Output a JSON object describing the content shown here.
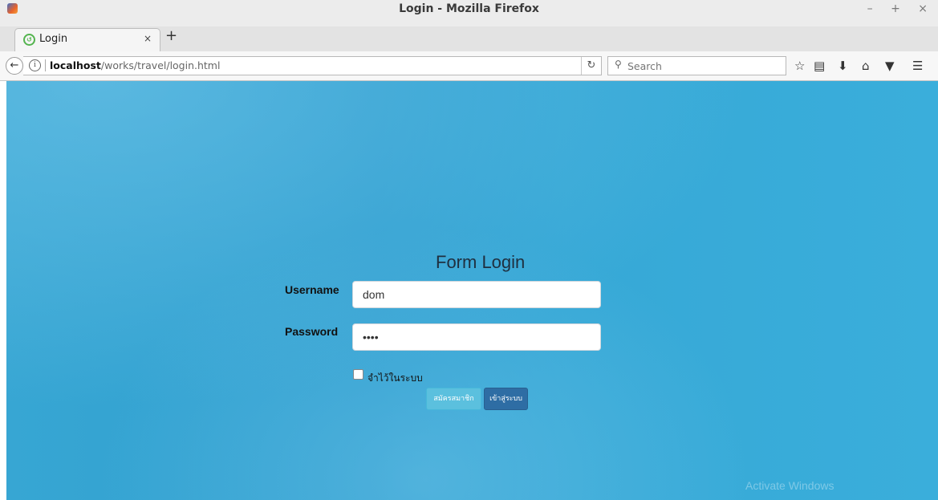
{
  "window": {
    "title": "Login - Mozilla Firefox",
    "controls": "– + ×"
  },
  "tabs": [
    {
      "label": "Login",
      "close": "×",
      "active": true
    }
  ],
  "new_tab_label": "+",
  "nav": {
    "back_glyph": "🡐",
    "url_host": "localhost",
    "url_path": "/works/travel/login.html",
    "reload_glyph": "C",
    "search_placeholder": "Search"
  },
  "toolbar_icons": [
    "bookmark-star-icon",
    "reading-list-icon",
    "download-icon",
    "home-icon",
    "pocket-icon",
    "menu-icon"
  ],
  "form": {
    "title": "Form Login",
    "username_label": "Username",
    "username_value": "dom",
    "password_label": "Password",
    "password_value": "dddd",
    "remember_label": "จำไว้ในระบบ",
    "remember_checked": false,
    "register_label": "สมัครสมาชิก",
    "login_label": "เข้าสู่ระบบ"
  },
  "watermark": "Activate Windows",
  "colors": {
    "page_background": "#34a6d6",
    "register_button": "#5bc0de",
    "login_button": "#2e6da4"
  }
}
